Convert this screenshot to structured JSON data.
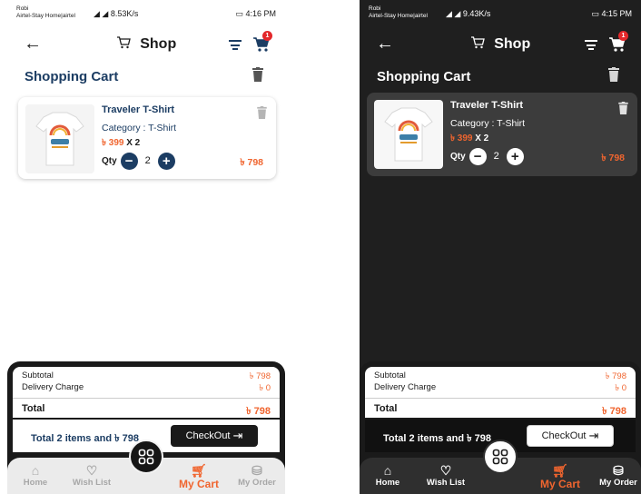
{
  "light": {
    "status": {
      "carrier1": "Robi",
      "carrier2": "Airtel-Stay Home|airtel",
      "speed": "8.53K/s",
      "time": "4:16 PM"
    },
    "appbar": {
      "title": "Shop",
      "badge": "1"
    },
    "section_title": "Shopping Cart",
    "item": {
      "name": "Traveler T-Shirt",
      "category": "Category : T-Shirt",
      "unit_price": "৳ 399",
      "multiplier": "X 2",
      "qty_label": "Qty",
      "qty": "2",
      "line_total": "৳ 798"
    },
    "summary": {
      "subtotal_label": "Subtotal",
      "subtotal": "৳ 798",
      "delivery_label": "Delivery Charge",
      "delivery": "৳ 0",
      "total_label": "Total",
      "total": "৳ 798",
      "items_text": "Total 2 items and ৳ 798",
      "checkout": "CheckOut"
    },
    "nav": {
      "home": "Home",
      "wishlist": "Wish List",
      "cart": "My Cart",
      "orders": "My Order"
    }
  },
  "dark": {
    "status": {
      "carrier1": "Robi",
      "carrier2": "Airtel-Stay Home|airtel",
      "speed": "9.43K/s",
      "time": "4:15 PM"
    },
    "appbar": {
      "title": "Shop",
      "badge": "1"
    },
    "section_title": "Shopping Cart",
    "item": {
      "name": "Traveler T-Shirt",
      "category": "Category : T-Shirt",
      "unit_price": "৳ 399",
      "multiplier": "X 2",
      "qty_label": "Qty",
      "qty": "2",
      "line_total": "৳ 798"
    },
    "summary": {
      "subtotal_label": "Subtotal",
      "subtotal": "৳ 798",
      "delivery_label": "Delivery Charge",
      "delivery": "৳ 0",
      "total_label": "Total",
      "total": "৳ 798",
      "items_text": "Total 2 items and ৳ 798",
      "checkout": "CheckOut"
    },
    "nav": {
      "home": "Home",
      "wishlist": "Wish List",
      "cart": "My Cart",
      "orders": "My Order"
    }
  },
  "colors": {
    "accent": "#f0652f",
    "navy": "#1c3d63",
    "dark_bg": "#1f1f1f",
    "badge": "#e3282b"
  },
  "icons": [
    "back-arrow-icon",
    "cart-icon",
    "filter-icon",
    "trash-icon",
    "minus-icon",
    "plus-icon",
    "home-icon",
    "heart-icon",
    "basket-icon",
    "grid-menu-icon",
    "checkout-arrow-icon"
  ]
}
